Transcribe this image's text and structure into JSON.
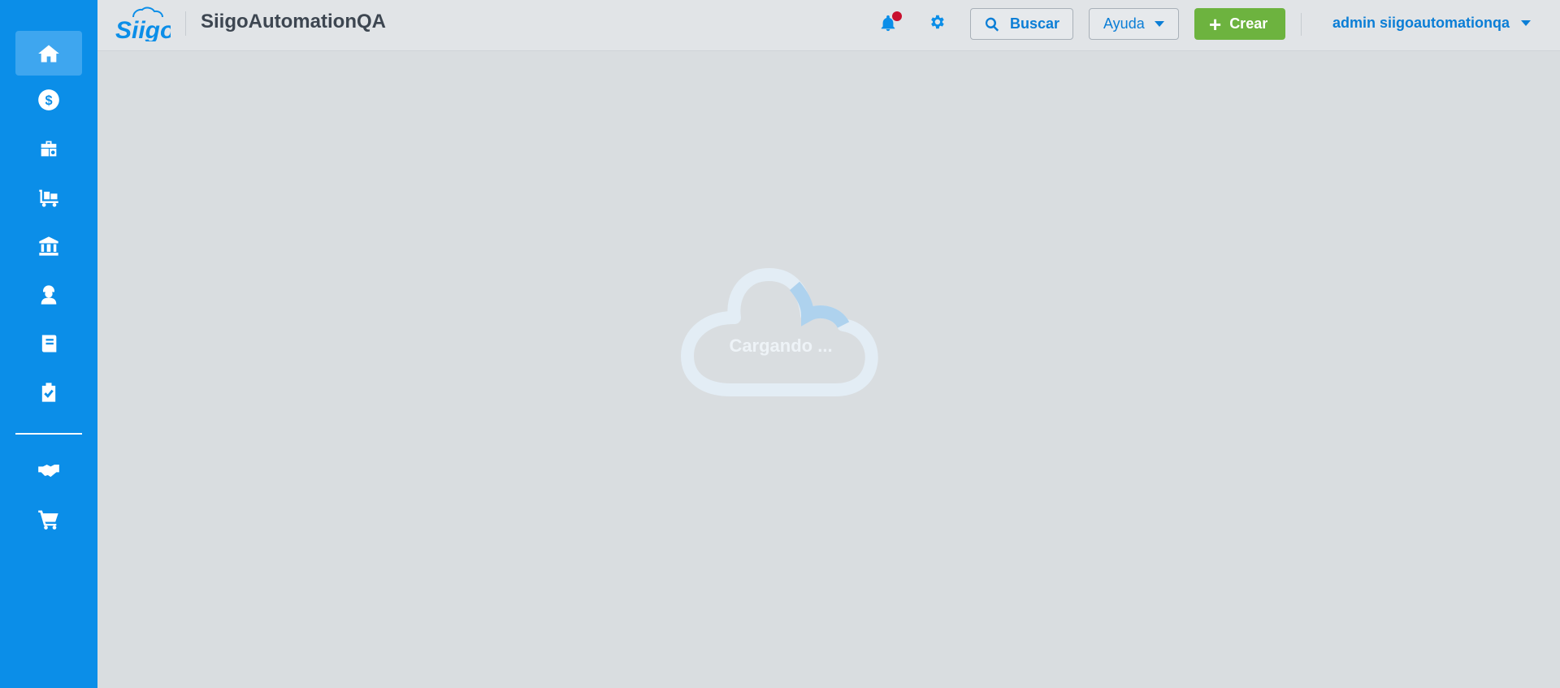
{
  "header": {
    "logo_text": "Siigo",
    "company_name": "SiigoAutomationQA",
    "search_label": "Buscar",
    "help_label": "Ayuda",
    "create_label": "Crear",
    "user_name": "admin siigoautomationqa"
  },
  "loader": {
    "text": "Cargando ..."
  },
  "sidebar": {
    "items": [
      {
        "icon": "home-icon",
        "active": true
      },
      {
        "icon": "dollar-icon"
      },
      {
        "icon": "briefcase-icon"
      },
      {
        "icon": "inventory-cart-icon"
      },
      {
        "icon": "bank-icon"
      },
      {
        "icon": "worker-icon"
      },
      {
        "icon": "book-icon"
      },
      {
        "icon": "clipboard-check-icon"
      },
      {
        "icon": "handshake-icon"
      },
      {
        "icon": "shopping-cart-icon"
      }
    ]
  },
  "colors": {
    "sidebar": "#0b8ee8",
    "header_bg": "#e1e4e7",
    "content_bg": "#d9dde0",
    "accent_blue": "#0b7ed6",
    "create_green": "#6db33f",
    "notification_dot": "#c8102e"
  }
}
